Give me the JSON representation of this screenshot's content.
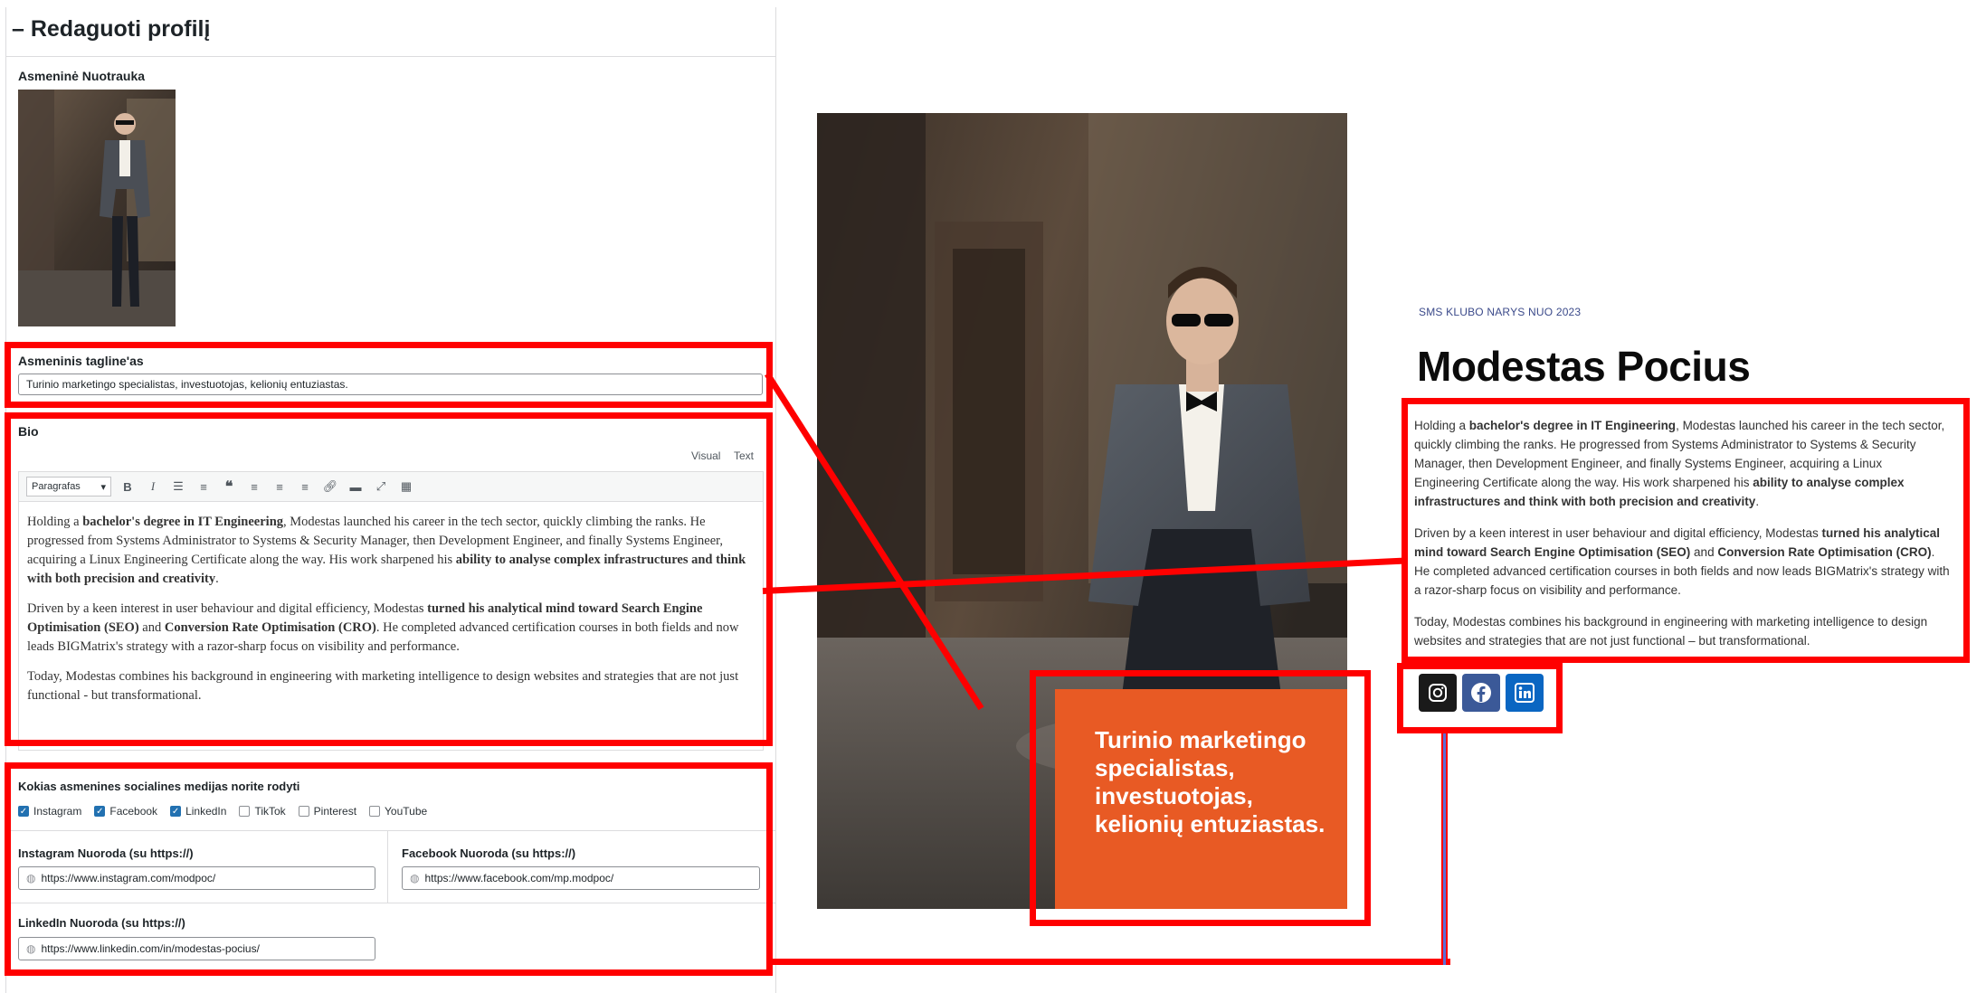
{
  "editor": {
    "title": "– Redaguoti profilį",
    "photo_label": "Asmeninė Nuotrauka",
    "tagline_label": "Asmeninis tagline'as",
    "tagline_value": "Turinio marketingo specialistas, investuotojas, kelionių entuziastas.",
    "bio_label": "Bio",
    "mode_tabs": [
      "Visual",
      "Text"
    ],
    "format_select": "Paragrafas",
    "bio_paragraphs": [
      [
        "Holding a ",
        "bachelor's degree in IT Engineering",
        ", Modestas launched his career in the tech sector, quickly climbing the ranks. He progressed from Systems Administrator to Systems & Security Manager, then Development Engineer, and finally Systems Engineer, acquiring a Linux Engineering Certificate along the way. His work sharpened his ",
        "ability to analyse complex infrastructures and think with both precision and creativity",
        "."
      ],
      [
        "Driven by a keen interest in user behaviour and digital efficiency, Modestas ",
        "turned his analytical mind toward Search Engine Optimisation (SEO)",
        " and ",
        "Conversion Rate Optimisation (CRO)",
        ". He completed advanced certification courses in both fields and now leads BIGMatrix's strategy with a razor-sharp focus on visibility and performance."
      ],
      [
        "Today, Modestas combines his background in engineering with marketing intelligence to design websites and strategies that are not just functional - but transformational."
      ]
    ],
    "social_label": "Kokias asmenines socialines medijas norite rodyti",
    "social_options": [
      {
        "label": "Instagram",
        "checked": true
      },
      {
        "label": "Facebook",
        "checked": true
      },
      {
        "label": "LinkedIn",
        "checked": true
      },
      {
        "label": "TikTok",
        "checked": false
      },
      {
        "label": "Pinterest",
        "checked": false
      },
      {
        "label": "YouTube",
        "checked": false
      }
    ],
    "instagram_label": "Instagram Nuoroda (su https://)",
    "instagram_value": "https://www.instagram.com/modpoc/",
    "facebook_label": "Facebook Nuoroda (su https://)",
    "facebook_value": "https://www.facebook.com/mp.modpoc/",
    "linkedin_label": "LinkedIn Nuoroda (su https://)",
    "linkedin_value": "https://www.linkedin.com/in/modestas-pocius/"
  },
  "profile": {
    "kicker": "SMS KLUBO NARYS NUO 2023",
    "name": "Modestas Pocius",
    "tagline_card": "Turinio marketingo specialistas, investuotojas, kelionių entuziastas.",
    "bio_paragraphs": [
      [
        "Holding a ",
        "bachelor's degree in IT Engineering",
        ", Modestas launched his career in the tech sector, quickly climbing the ranks. He progressed from Systems Administrator to Systems & Security Manager, then Development Engineer, and finally Systems Engineer, acquiring a Linux Engineering Certificate along the way. His work sharpened his ",
        "ability to analyse complex infrastructures and think with both precision and creativity",
        "."
      ],
      [
        "Driven by a keen interest in user behaviour and digital efficiency, Modestas ",
        "turned his analytical mind toward Search Engine Optimisation (SEO)",
        " and ",
        "Conversion Rate Optimisation (CRO)",
        ". He completed advanced certification courses in both fields and now leads BIGMatrix's strategy with a razor-sharp focus on visibility and performance."
      ],
      [
        "Today, Modestas combines his background in engineering with marketing intelligence to design websites and strategies that are not just functional – but transformational."
      ]
    ],
    "social_icons": [
      "instagram-icon",
      "facebook-icon",
      "linkedin-icon"
    ]
  },
  "colors": {
    "highlight": "#ff0000",
    "tagline_card_bg": "#e85a24",
    "instagram_bg": "#1a1a1a",
    "facebook_bg": "#3b5998",
    "linkedin_bg": "#0a66c2",
    "kicker": "#3b4a8a"
  }
}
